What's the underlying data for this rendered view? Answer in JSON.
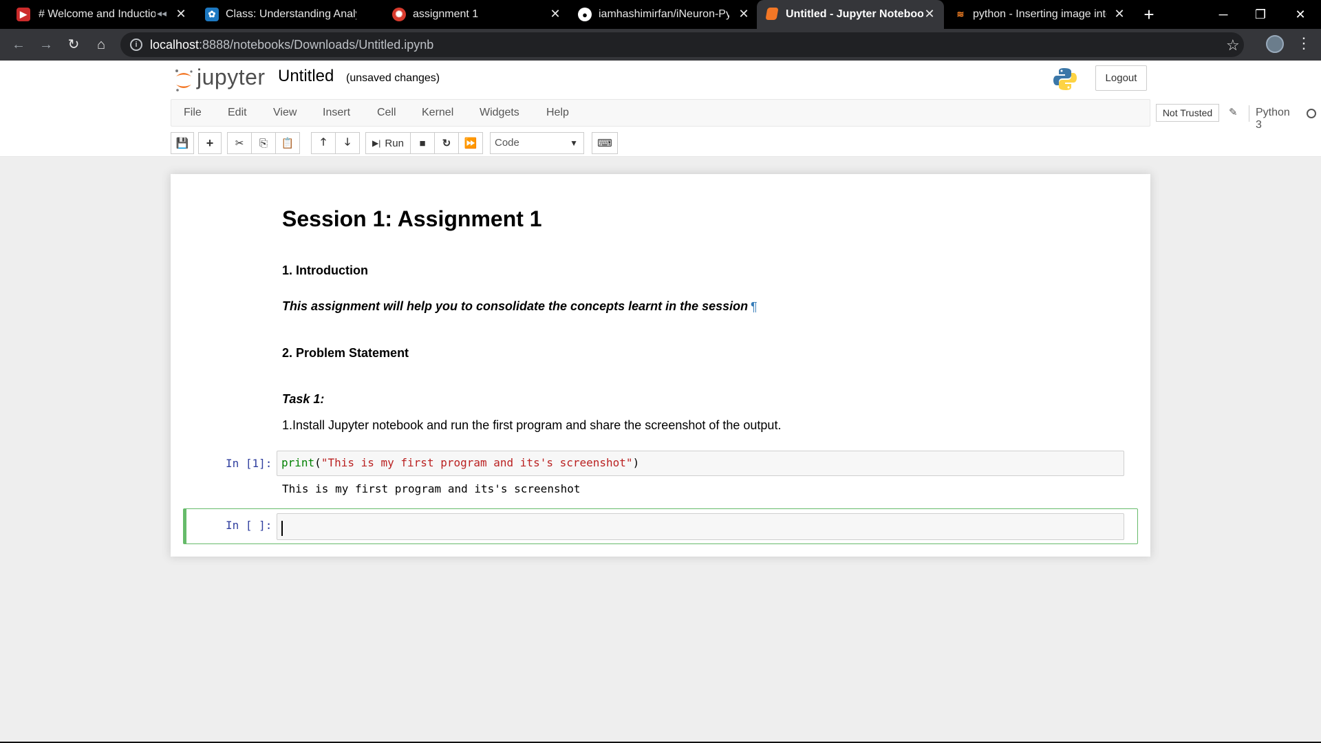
{
  "browser": {
    "tabs": [
      {
        "title": "# Welcome and Inductio",
        "muted": true
      },
      {
        "title": "Class: Understanding Analytic"
      },
      {
        "title": "assignment 1"
      },
      {
        "title": "iamhashimirfan/iNeuron-Py"
      },
      {
        "title": "Untitled - Jupyter Notebook",
        "active": true
      },
      {
        "title": "python - Inserting image into"
      }
    ],
    "url_host": "localhost",
    "url_rest": ":8888/notebooks/Downloads/Untitled.ipynb"
  },
  "header": {
    "logo": "jupyter",
    "notebook_name": "Untitled",
    "save_status": "(unsaved changes)",
    "logout_label": "Logout"
  },
  "menubar": {
    "items": [
      "File",
      "Edit",
      "View",
      "Insert",
      "Cell",
      "Kernel",
      "Widgets",
      "Help"
    ],
    "trust": "Not Trusted",
    "kernel": "Python 3"
  },
  "toolbar": {
    "run_label": "Run",
    "cell_type": "Code"
  },
  "notebook": {
    "heading": "Session 1: Assignment 1",
    "intro_heading": "1. Introduction",
    "intro_text": "This assignment will help you to consolidate the concepts learnt in the session",
    "anchor_symbol": "¶",
    "problem_heading": "2. Problem Statement",
    "task_heading": "Task 1:",
    "task_text": "1.Install Jupyter notebook and run the first program and share the screenshot of the output.",
    "cell1": {
      "prompt": "In [1]:",
      "code_fn": "print",
      "code_open": "(",
      "code_string": "\"This is my first program and its's screenshot\"",
      "code_close": ")",
      "output": "This is my first program and its's screenshot"
    },
    "cell2": {
      "prompt": "In [ ]:"
    }
  },
  "colors": {
    "jupyter_orange": "#f37726",
    "selected_cell_border": "#66bb6a",
    "prompt_blue": "#303f9f"
  }
}
